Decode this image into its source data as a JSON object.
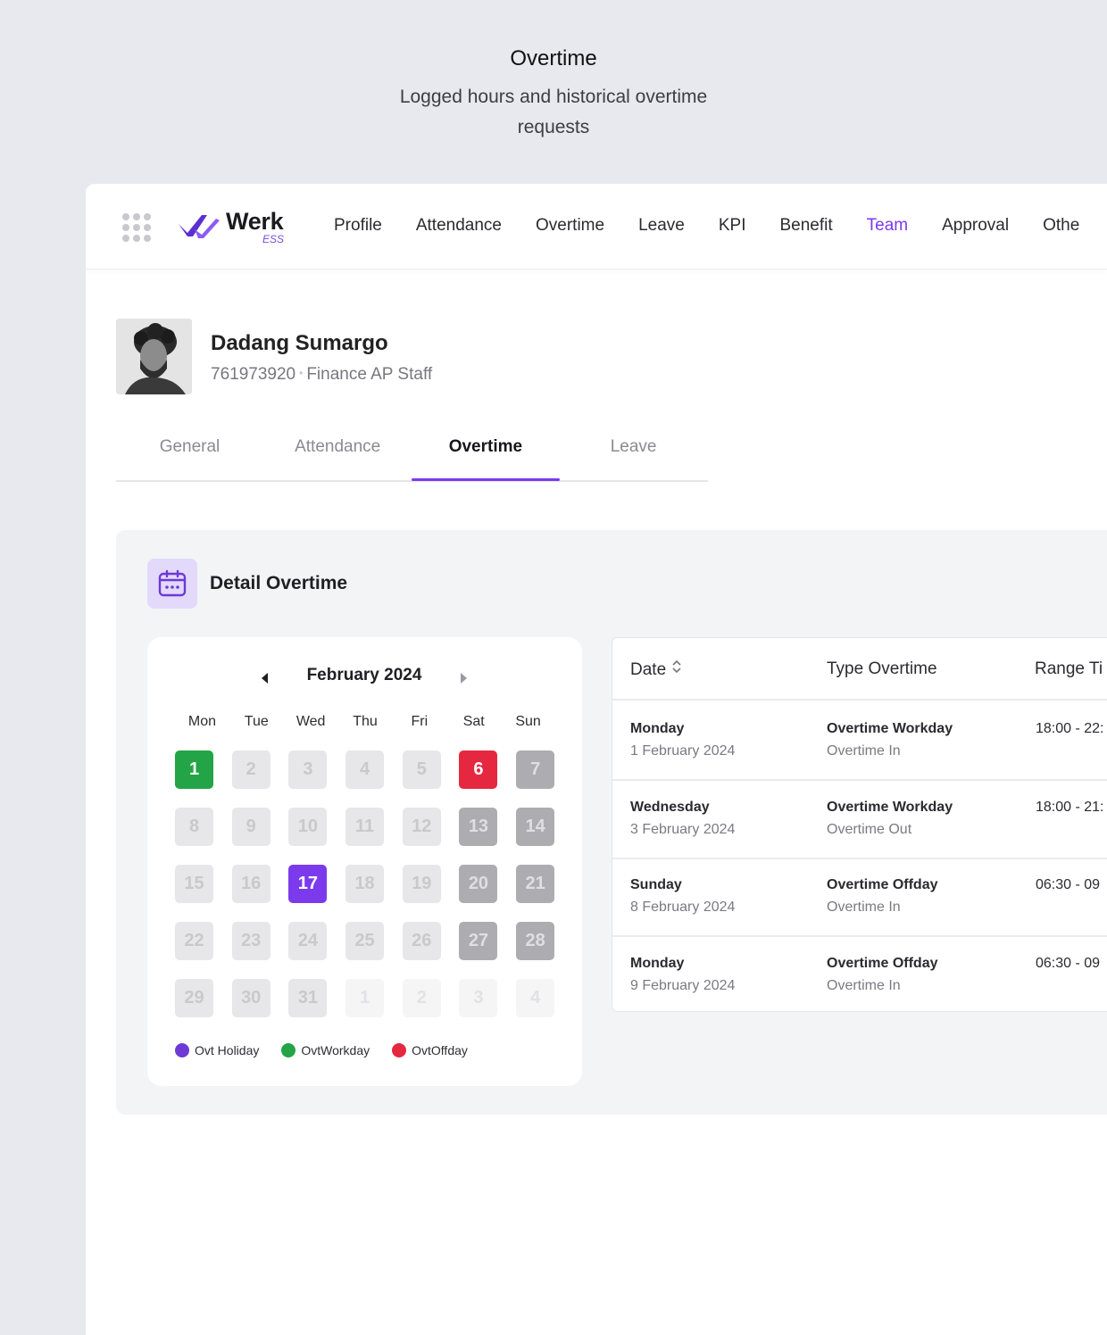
{
  "hero": {
    "title": "Overtime",
    "subtitle": "Logged hours and historical overtime requests"
  },
  "navbar": {
    "logo_word": "Werk",
    "logo_sub": "ESS",
    "items": [
      "Profile",
      "Attendance",
      "Overtime",
      "Leave",
      "KPI",
      "Benefit",
      "Team",
      "Approval",
      "Othe"
    ],
    "active_index": 6
  },
  "profile": {
    "name": "Dadang Sumargo",
    "employee_id": "761973920",
    "separator": "•",
    "position": "Finance AP Staff"
  },
  "tabs": {
    "items": [
      "General",
      "Attendance",
      "Overtime",
      "Leave"
    ],
    "active_index": 2
  },
  "detail": {
    "title": "Detail Overtime"
  },
  "calendar": {
    "month_label": "February 2024",
    "weekdays": [
      "Mon",
      "Tue",
      "Wed",
      "Thu",
      "Fri",
      "Sat",
      "Sun"
    ],
    "days": [
      {
        "n": "1",
        "kind": "workday"
      },
      {
        "n": "2",
        "kind": "dim"
      },
      {
        "n": "3",
        "kind": "dim"
      },
      {
        "n": "4",
        "kind": "dim"
      },
      {
        "n": "5",
        "kind": "dim"
      },
      {
        "n": "6",
        "kind": "offday"
      },
      {
        "n": "7",
        "kind": "weekend"
      },
      {
        "n": "8",
        "kind": "dim"
      },
      {
        "n": "9",
        "kind": "dim"
      },
      {
        "n": "10",
        "kind": "dim"
      },
      {
        "n": "11",
        "kind": "dim"
      },
      {
        "n": "12",
        "kind": "dim"
      },
      {
        "n": "13",
        "kind": "weekend"
      },
      {
        "n": "14",
        "kind": "weekend"
      },
      {
        "n": "15",
        "kind": "dim"
      },
      {
        "n": "16",
        "kind": "dim"
      },
      {
        "n": "17",
        "kind": "holiday"
      },
      {
        "n": "18",
        "kind": "dim"
      },
      {
        "n": "19",
        "kind": "dim"
      },
      {
        "n": "20",
        "kind": "weekend"
      },
      {
        "n": "21",
        "kind": "weekend"
      },
      {
        "n": "22",
        "kind": "dim"
      },
      {
        "n": "23",
        "kind": "dim"
      },
      {
        "n": "24",
        "kind": "dim"
      },
      {
        "n": "25",
        "kind": "dim"
      },
      {
        "n": "26",
        "kind": "dim"
      },
      {
        "n": "27",
        "kind": "weekend"
      },
      {
        "n": "28",
        "kind": "weekend"
      },
      {
        "n": "29",
        "kind": "dim"
      },
      {
        "n": "30",
        "kind": "dim"
      },
      {
        "n": "31",
        "kind": "dim"
      },
      {
        "n": "1",
        "kind": "other"
      },
      {
        "n": "2",
        "kind": "other"
      },
      {
        "n": "3",
        "kind": "other"
      },
      {
        "n": "4",
        "kind": "other"
      }
    ],
    "legend": [
      {
        "label": "Ovt Holiday",
        "color": "#6d3ad6"
      },
      {
        "label": "OvtWorkday",
        "color": "#22a447"
      },
      {
        "label": "OvtOffday",
        "color": "#e5283f"
      }
    ]
  },
  "table": {
    "headers": {
      "date": "Date",
      "type": "Type Overtime",
      "range": "Range Ti"
    },
    "rows": [
      {
        "day": "Monday",
        "date": "1 February 2024",
        "type": "Overtime Workday",
        "direction": "Overtime In",
        "range": "18:00 - 22:"
      },
      {
        "day": "Wednesday",
        "date": "3 February 2024",
        "type": "Overtime Workday",
        "direction": "Overtime Out",
        "range": "18:00 - 21:"
      },
      {
        "day": "Sunday",
        "date": "8 February 2024",
        "type": "Overtime Offday",
        "direction": "Overtime In",
        "range": "06:30 - 09"
      },
      {
        "day": "Monday",
        "date": "9 February 2024",
        "type": "Overtime Offday",
        "direction": "Overtime In",
        "range": "06:30 - 09"
      }
    ]
  },
  "colors": {
    "accent": "#7c3aed",
    "workday": "#22a447",
    "offday": "#e5283f",
    "holiday": "#7c3aed",
    "background": "#e8e9ee"
  }
}
